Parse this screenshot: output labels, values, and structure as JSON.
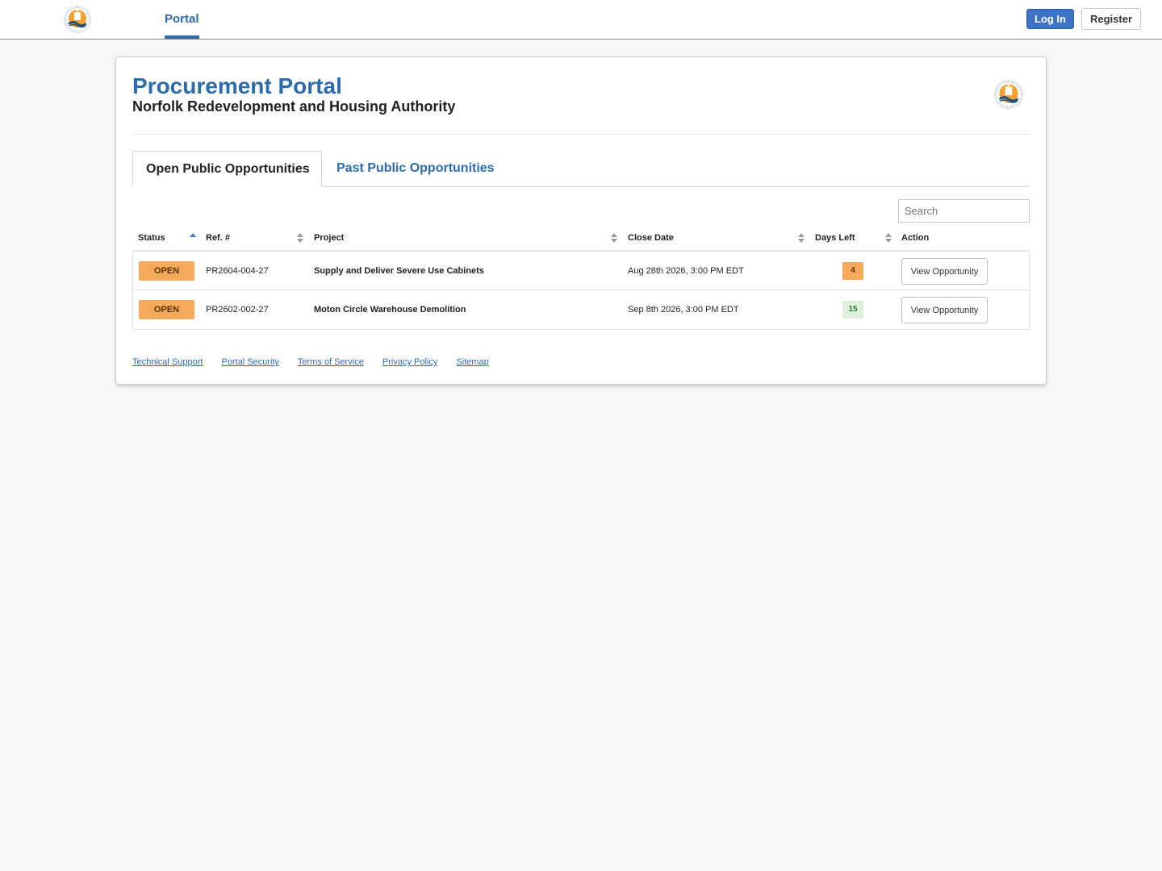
{
  "nav": {
    "logo": "nrha-logo",
    "tab": "Portal",
    "login_label": "Log In",
    "register_label": "Register"
  },
  "colors": {
    "primary": "#2b6cb0",
    "login_button": "#3d72c7",
    "open_badge": "#f5a95a",
    "days_warn": "#f6a95a",
    "days_ok": "#dff0dc",
    "background": "#f7f7f7"
  },
  "portal": {
    "title": "Procurement Portal",
    "subtitle": "Norfolk Redevelopment and Housing Authority"
  },
  "tabs": [
    {
      "label": "Open Public Opportunities",
      "active": true
    },
    {
      "label": "Past Public Opportunities",
      "active": false
    }
  ],
  "search": {
    "placeholder": "Search"
  },
  "table": {
    "columns": [
      "Status",
      "Ref. #",
      "Project",
      "Close Date",
      "Days Left",
      "Action"
    ],
    "sorted_by": "Status",
    "rows": [
      {
        "status": "OPEN",
        "ref": "PR2604-004-27",
        "project": "Supply and Deliver Severe Use Cabinets",
        "close_date": "Aug 28th 2026, 3:00 PM EDT",
        "days_left": "4",
        "action": "View Opportunity"
      },
      {
        "status": "OPEN",
        "ref": "PR2602-002-27",
        "project": "Moton Circle Warehouse Demolition",
        "close_date": "Sep 8th 2026, 3:00 PM EDT",
        "days_left": "15",
        "action": "View Opportunity"
      }
    ]
  },
  "footer": {
    "links": [
      "Technical Support",
      "Portal Security",
      "Terms of Service",
      "Privacy Policy",
      "Sitemap"
    ]
  }
}
